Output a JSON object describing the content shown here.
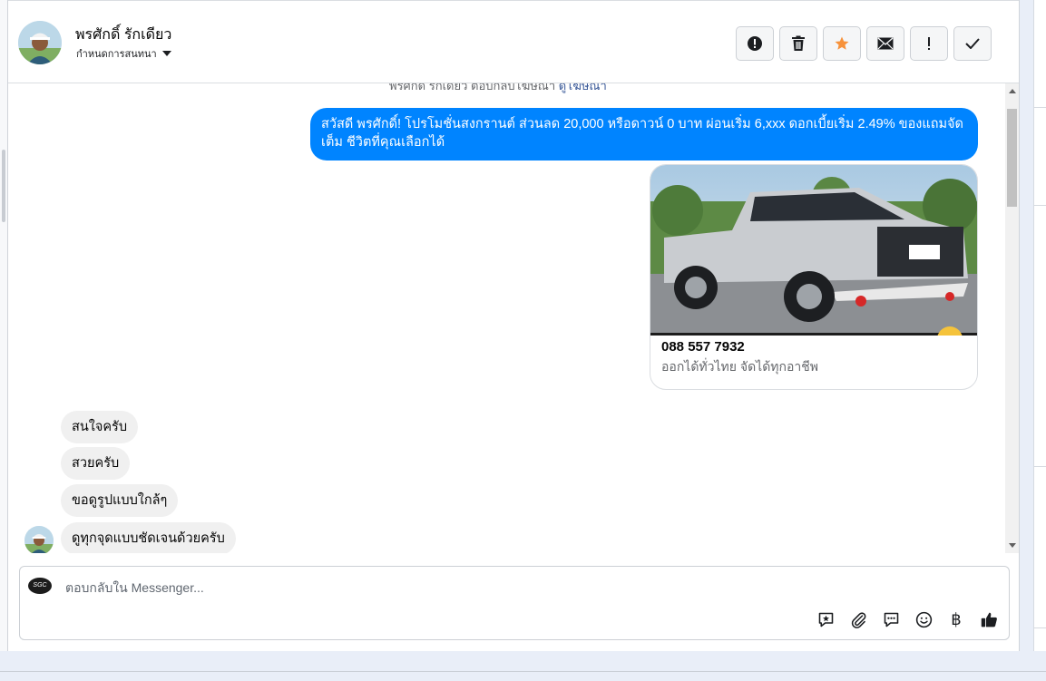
{
  "header": {
    "contact_name": "พรศักดิ์ รักเดียว",
    "assign_label": "กำหนดการสนทนา",
    "actions": [
      {
        "name": "spam",
        "icon": "exclamation-circle-icon"
      },
      {
        "name": "delete",
        "icon": "trash-icon"
      },
      {
        "name": "star",
        "icon": "star-icon",
        "color": "#f7923b"
      },
      {
        "name": "mark-unread",
        "icon": "envelope-icon"
      },
      {
        "name": "follow-up",
        "icon": "exclamation-icon"
      },
      {
        "name": "mark-done",
        "icon": "check-icon"
      }
    ]
  },
  "conversation": {
    "clipped_note": "พรศักดิ์ รักเดียว ตอบกลับโฆษณา",
    "clipped_link": "ดูโฆษณา",
    "outgoing": {
      "text": "สวัสดี พรศักดิ์! โปรโมชั่นสงกรานต์ ส่วนลด 20,000 หรือดาวน์ 0 บาท ผ่อนเริ่ม 6,xxx ดอกเบี้ยเริ่ม 2.49% ของแถมจัดเต็ม ชีวิตที่คุณเลือกได้",
      "color": "#0084ff"
    },
    "card": {
      "title": "088 557 7932",
      "subtitle": "ออกได้ทั่วไทย จัดได้ทุกอาชีพ"
    },
    "incoming": [
      {
        "text": "สนใจครับ"
      },
      {
        "text": "สวยครับ"
      },
      {
        "text": "ขอดูรูปแบบใกล้ๆ"
      },
      {
        "text": "ดูทุกจุดแบบชัดเจนด้วยครับ"
      }
    ]
  },
  "composer": {
    "placeholder": "ตอบกลับใน Messenger...",
    "page_avatar_text": "SGC",
    "tools": [
      {
        "name": "saved-replies",
        "icon": "saved-reply-icon"
      },
      {
        "name": "attach",
        "icon": "paperclip-icon"
      },
      {
        "name": "quick-replies",
        "icon": "chat-bubble-icon"
      },
      {
        "name": "emoji",
        "icon": "smiley-icon"
      },
      {
        "name": "payment",
        "icon": "baht-icon",
        "label": "฿"
      },
      {
        "name": "like",
        "icon": "thumbs-up-icon"
      }
    ]
  }
}
